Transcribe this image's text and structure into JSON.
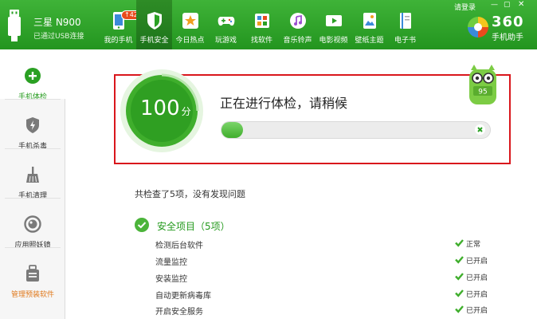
{
  "device": {
    "name": "三星 N900",
    "status": "已通过USB连接"
  },
  "nav": [
    {
      "label": "我的手机",
      "icon": "my-phone-icon",
      "badge": "42"
    },
    {
      "label": "手机安全",
      "icon": "shield-icon",
      "active": true
    },
    {
      "label": "今日热点",
      "icon": "star-icon"
    },
    {
      "label": "玩游戏",
      "icon": "gamepad-icon"
    },
    {
      "label": "找软件",
      "icon": "apps-icon"
    },
    {
      "label": "音乐铃声",
      "icon": "music-icon"
    },
    {
      "label": "电影视频",
      "icon": "video-icon"
    },
    {
      "label": "壁纸主题",
      "icon": "wallpaper-icon"
    },
    {
      "label": "电子书",
      "icon": "ebook-icon"
    }
  ],
  "header": {
    "login": "请登录",
    "win_min": "—",
    "win_max": "▢",
    "win_close": "✕",
    "brand_num": "360",
    "brand_sub": "手机助手"
  },
  "sidebar": {
    "items": [
      {
        "label": "手机体检",
        "icon": "checkup-plus-icon",
        "active": true
      },
      {
        "label": "手机杀毒",
        "icon": "antivirus-lightning-icon"
      },
      {
        "label": "手机清理",
        "icon": "broom-icon"
      },
      {
        "label": "应用照妖镜",
        "icon": "mirror-icon"
      },
      {
        "label": "管理预装软件",
        "icon": "preinstall-box-icon",
        "highlight": true
      }
    ]
  },
  "checkup": {
    "score": "100",
    "unit": "分",
    "title": "正在进行体检，请稍候",
    "progress": 0.08,
    "mascot_level": "95"
  },
  "results": {
    "summary": "共检查了5项，没有发现问题",
    "section": "安全项目（5项）",
    "rows": [
      {
        "name": "检测后台软件",
        "status": "正常"
      },
      {
        "name": "流量监控",
        "status": "已开启"
      },
      {
        "name": "安装监控",
        "status": "已开启"
      },
      {
        "name": "自动更新病毒库",
        "status": "已开启"
      },
      {
        "name": "开启安全服务",
        "status": "已开启"
      }
    ]
  },
  "colors": {
    "accent": "#2aa023",
    "header": "#23951f",
    "panel_border": "#d9161c",
    "highlight": "#e07a1e"
  }
}
